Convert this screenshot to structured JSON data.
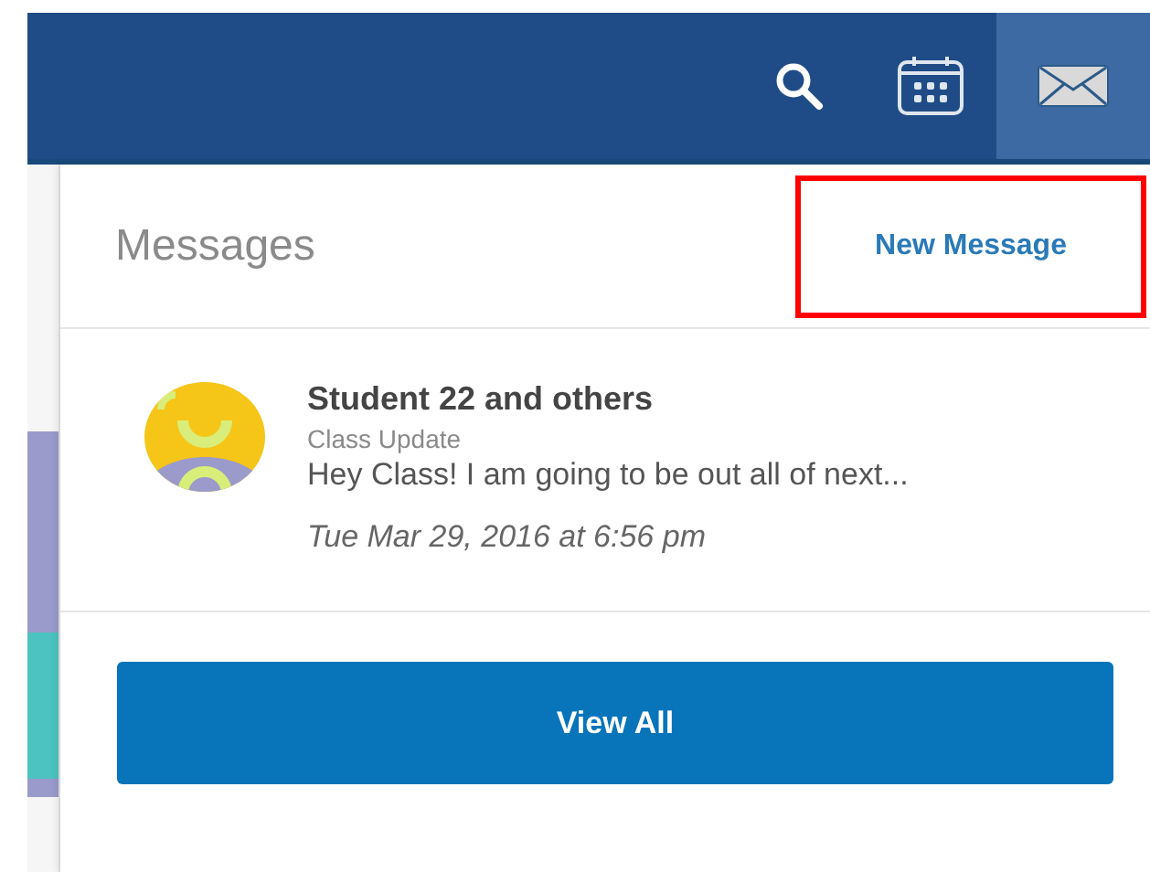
{
  "topbar": {
    "mail_active": true
  },
  "messages_panel": {
    "title": "Messages",
    "new_message": {
      "label": "New Message",
      "highlighted": true
    },
    "items": [
      {
        "sender": "Student 22 and others",
        "subject": "Class Update",
        "preview": "Hey Class! I am going to be out all of next...",
        "date": "Tue Mar 29, 2016 at 6:56 pm"
      }
    ],
    "view_all": "View All"
  }
}
